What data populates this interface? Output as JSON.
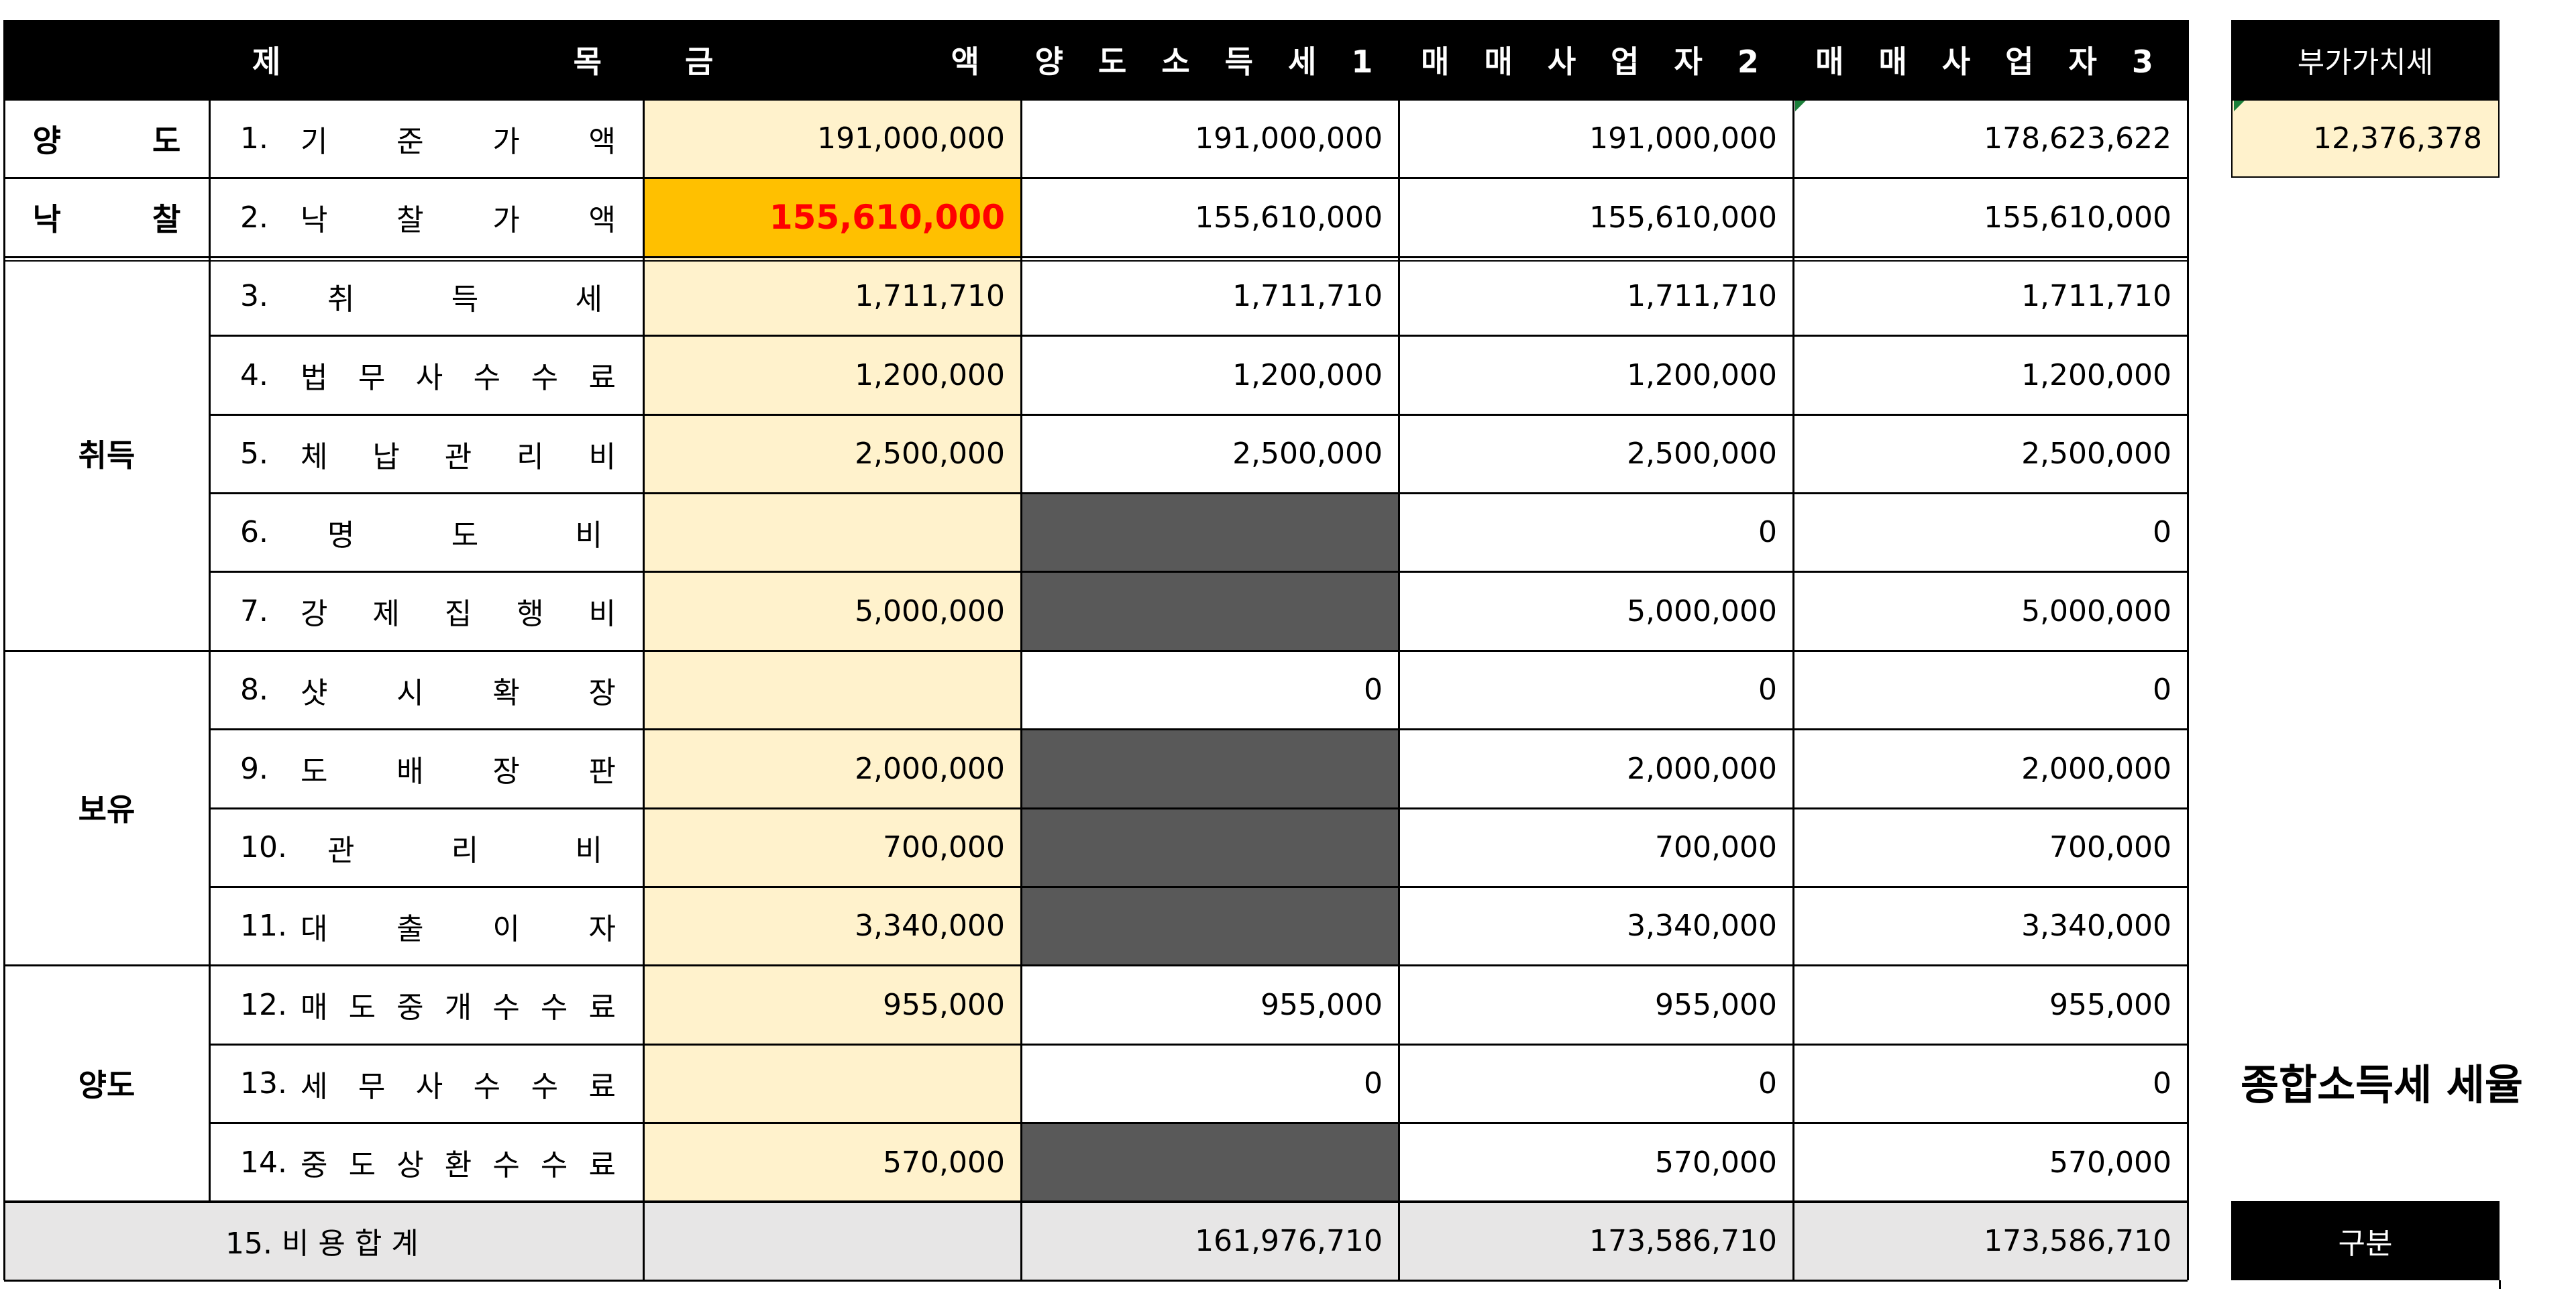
{
  "header": {
    "col_item_1": "제",
    "col_item_2": "목",
    "col_amount_1": "금",
    "col_amount_2": "액",
    "col_transfer_tax": "양 도 소 득 세 1",
    "col_dealer_2": "매 매 사 업 자 2",
    "col_dealer_3": "매 매 사 업 자 3",
    "col_vat": "부가가치세"
  },
  "groups": {
    "transfer_top": "양 도",
    "auction": "낙 찰",
    "acquisition": "취득",
    "holding": "보유",
    "transfer": "양도"
  },
  "rows": [
    {
      "no": "1.",
      "label": [
        "기",
        "준",
        "가",
        "액"
      ],
      "amount": "191,000,000",
      "tax": "191,000,000",
      "d2": "191,000,000",
      "d3": "178,623,622"
    },
    {
      "no": "2.",
      "label": [
        "낙",
        "찰",
        "가",
        "액"
      ],
      "amount": "155,610,000",
      "tax": "155,610,000",
      "d2": "155,610,000",
      "d3": "155,610,000"
    },
    {
      "no": "3.",
      "label": [
        "취",
        "득",
        "세"
      ],
      "amount": "1,711,710",
      "tax": "1,711,710",
      "d2": "1,711,710",
      "d3": "1,711,710"
    },
    {
      "no": "4.",
      "label": [
        "법",
        "무",
        "사",
        "수",
        "수",
        "료"
      ],
      "amount": "1,200,000",
      "tax": "1,200,000",
      "d2": "1,200,000",
      "d3": "1,200,000"
    },
    {
      "no": "5.",
      "label": [
        "체",
        "납",
        "관",
        "리",
        "비"
      ],
      "amount": "2,500,000",
      "tax": "2,500,000",
      "d2": "2,500,000",
      "d3": "2,500,000"
    },
    {
      "no": "6.",
      "label": [
        "명",
        "도",
        "비"
      ],
      "amount": "",
      "tax": "",
      "d2": "0",
      "d3": "0"
    },
    {
      "no": "7.",
      "label": [
        "강",
        "제",
        "집",
        "행",
        "비"
      ],
      "amount": "5,000,000",
      "tax": "",
      "d2": "5,000,000",
      "d3": "5,000,000"
    },
    {
      "no": "8.",
      "label": [
        "샷",
        "시",
        "확",
        "장"
      ],
      "amount": "",
      "tax": "0",
      "d2": "0",
      "d3": "0"
    },
    {
      "no": "9.",
      "label": [
        "도",
        "배",
        "장",
        "판"
      ],
      "amount": "2,000,000",
      "tax": "",
      "d2": "2,000,000",
      "d3": "2,000,000"
    },
    {
      "no": "10.",
      "label": [
        "관",
        "리",
        "비"
      ],
      "amount": "700,000",
      "tax": "",
      "d2": "700,000",
      "d3": "700,000"
    },
    {
      "no": "11.",
      "label": [
        "대",
        "출",
        "이",
        "자"
      ],
      "amount": "3,340,000",
      "tax": "",
      "d2": "3,340,000",
      "d3": "3,340,000"
    },
    {
      "no": "12.",
      "label": [
        "매",
        "도",
        "중",
        "개",
        "수",
        "수",
        "료"
      ],
      "amount": "955,000",
      "tax": "955,000",
      "d2": "955,000",
      "d3": "955,000"
    },
    {
      "no": "13.",
      "label": [
        "세",
        "무",
        "사",
        "수",
        "수",
        "료"
      ],
      "amount": "",
      "tax": "0",
      "d2": "0",
      "d3": "0"
    },
    {
      "no": "14.",
      "label": [
        "중",
        "도",
        "상",
        "환",
        "수",
        "수",
        "료"
      ],
      "amount": "570,000",
      "tax": "",
      "d2": "570,000",
      "d3": "570,000"
    }
  ],
  "total": {
    "label": "15. 비 용 합 계",
    "amount": "",
    "tax": "161,976,710",
    "d2": "173,586,710",
    "d3": "173,586,710"
  },
  "vat_value": "12,376,378",
  "side_title": "종합소득세 세율",
  "side_header": "구분",
  "colors": {
    "header_bg": "#000000",
    "input_yellow": "#fff2cc",
    "highlight_orange": "#ffc000",
    "highlight_text": "#ff0000",
    "disabled_gray": "#595959",
    "total_gray": "#e7e6e6"
  }
}
